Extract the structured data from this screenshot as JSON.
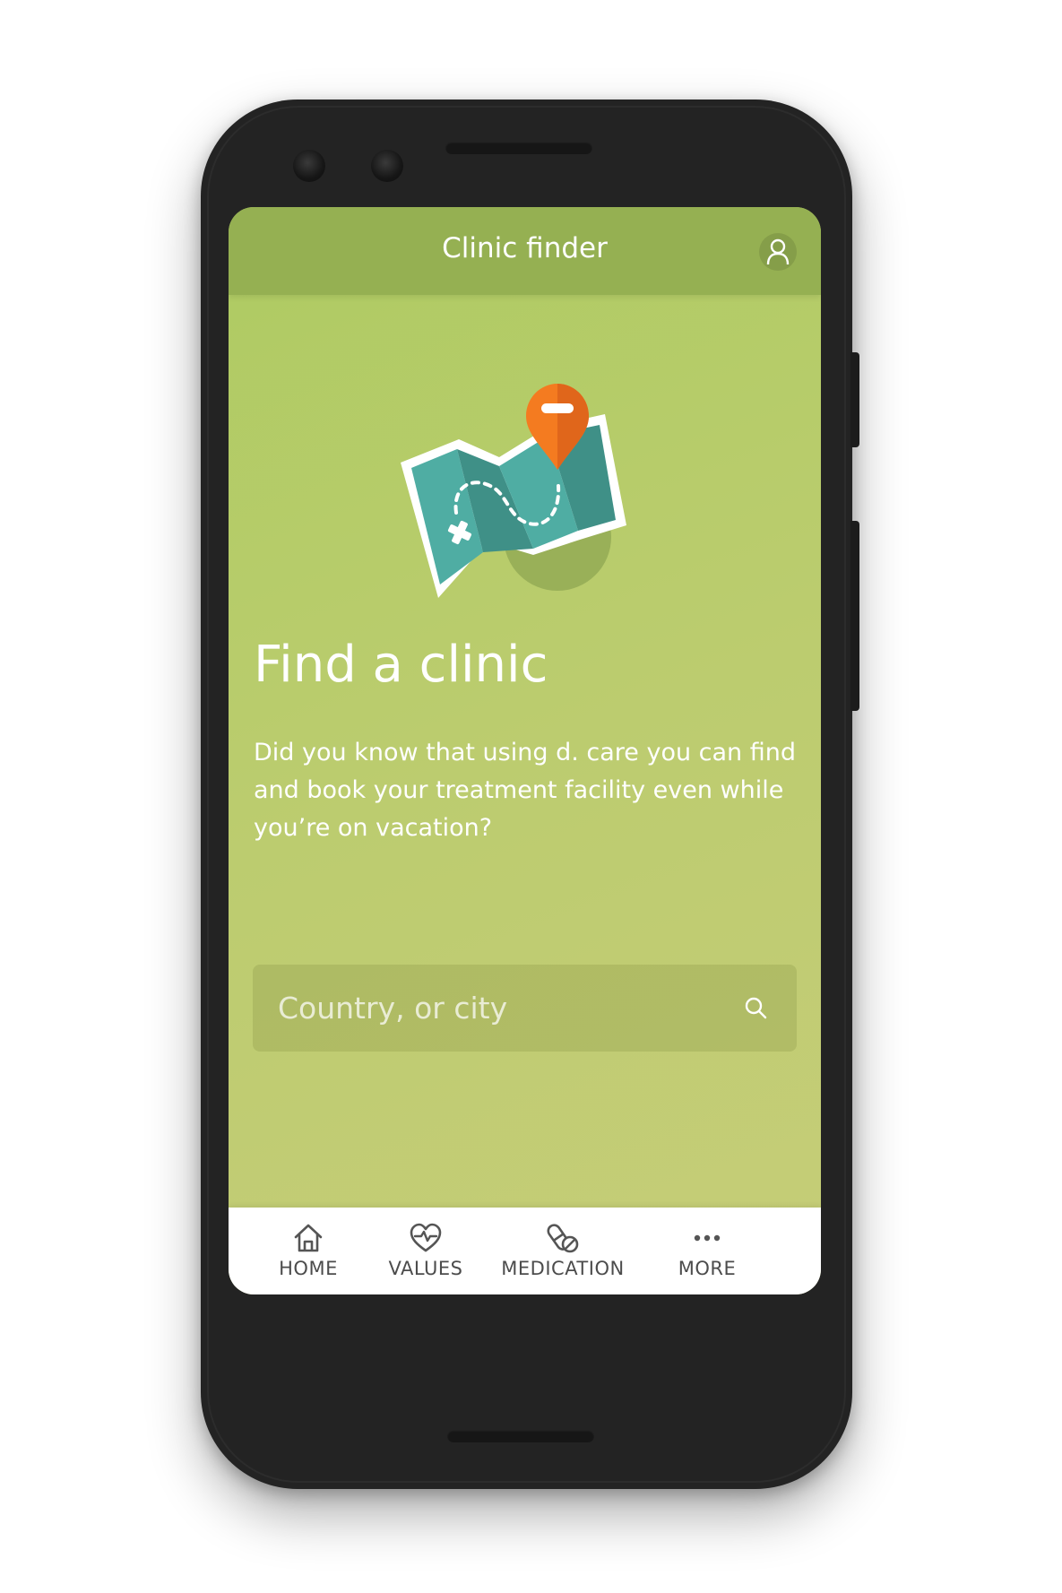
{
  "header": {
    "title": "Clinic finder",
    "profile_icon": "user-profile-icon"
  },
  "main": {
    "illustration_icon": "map-with-location-pin-icon",
    "heading": "Find a clinic",
    "description": "Did you know that using d. care you can find and book your treatment facility even while you’re on vacation?",
    "search": {
      "placeholder": "Country, or city",
      "value": "",
      "icon": "search-icon"
    }
  },
  "bottom_nav": {
    "items": [
      {
        "label": "HOME",
        "icon": "home-icon"
      },
      {
        "label": "VALUES",
        "icon": "heart-pulse-icon"
      },
      {
        "label": "MEDICATION",
        "icon": "pills-icon"
      },
      {
        "label": "MORE",
        "icon": "more-dots-icon"
      }
    ]
  },
  "colors": {
    "appbar": "#95b052",
    "background_start": "#aecb62",
    "background_end": "#c6cd78",
    "map_teal": "#4fada3",
    "pin_orange": "#f47b20",
    "nav_text": "#4c4c4c"
  }
}
